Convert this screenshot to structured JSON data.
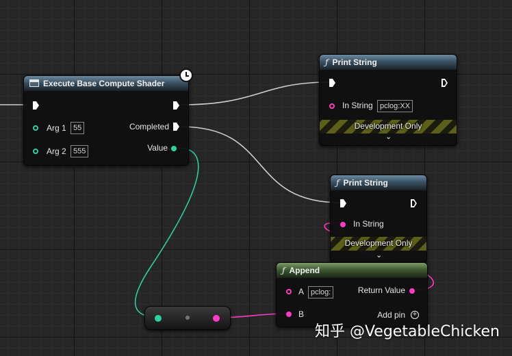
{
  "nodes": {
    "execute": {
      "title": "Execute Base Compute Shader",
      "arg1_label": "Arg 1",
      "arg1_value": "55",
      "arg2_label": "Arg 2",
      "arg2_value": "555",
      "completed_label": "Completed",
      "value_label": "Value"
    },
    "print1": {
      "title": "Print String",
      "instring_label": "In String",
      "instring_value": "pclog:XX",
      "dev_label": "Development Only"
    },
    "print2": {
      "title": "Print String",
      "instring_label": "In String",
      "dev_label": "Development Only"
    },
    "append": {
      "title": "Append",
      "a_label": "A",
      "a_value": "pclog:",
      "b_label": "B",
      "return_label": "Return Value",
      "addpin_label": "Add pin"
    }
  },
  "icons": {
    "function": "ƒ",
    "chevron": "⌄",
    "plus": "+"
  },
  "colors": {
    "exec_wire": "#cfcfcf",
    "int_wire": "#2ad1a0",
    "string_wire": "#ff3ac7",
    "header_blue": "#3b5263",
    "header_green": "#3f5a33"
  },
  "watermark": "知乎 @VegetableChicken"
}
